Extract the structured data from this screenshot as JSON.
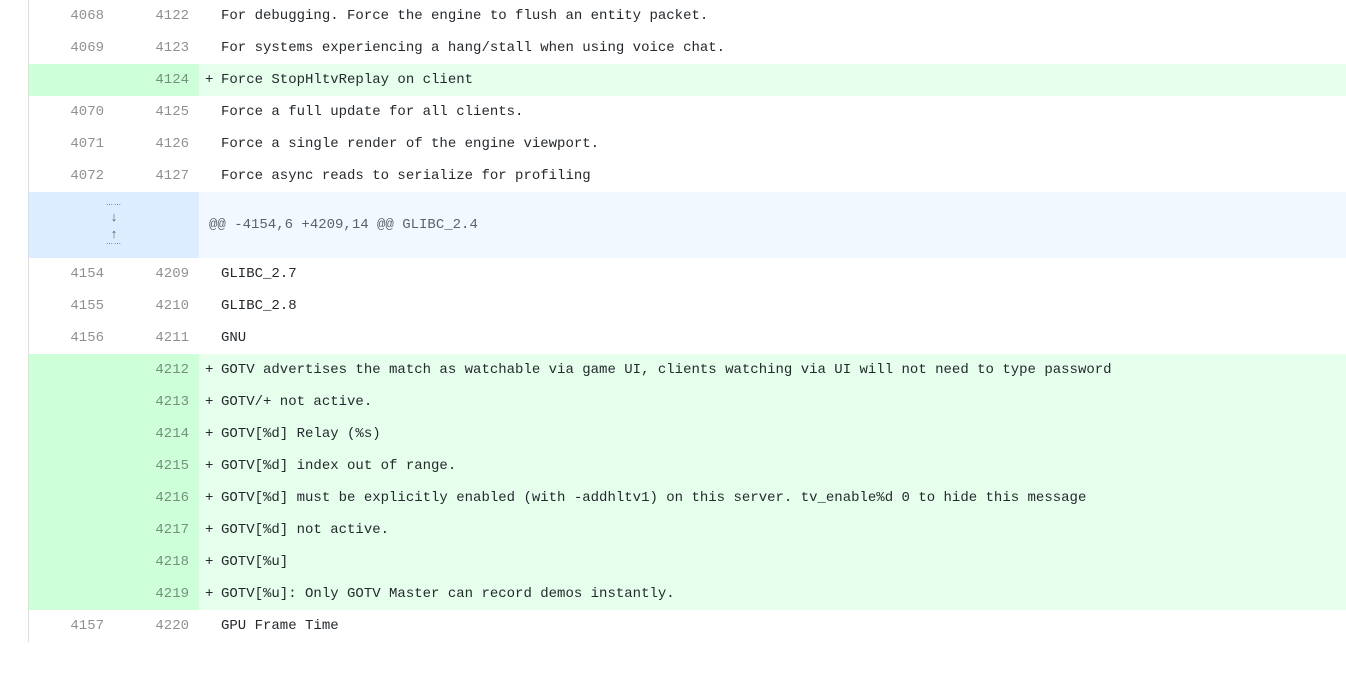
{
  "diff": {
    "rows": [
      {
        "type": "context",
        "old": "4068",
        "new": "4122",
        "marker": "",
        "text": "For debugging. Force the engine to flush an entity packet."
      },
      {
        "type": "context",
        "old": "4069",
        "new": "4123",
        "marker": "",
        "text": "For systems experiencing a hang/stall when using voice chat."
      },
      {
        "type": "addition",
        "old": "",
        "new": "4124",
        "marker": "+",
        "text": "Force StopHltvReplay on client"
      },
      {
        "type": "context",
        "old": "4070",
        "new": "4125",
        "marker": "",
        "text": "Force a full update for all clients."
      },
      {
        "type": "context",
        "old": "4071",
        "new": "4126",
        "marker": "",
        "text": "Force a single render of the engine viewport."
      },
      {
        "type": "context",
        "old": "4072",
        "new": "4127",
        "marker": "",
        "text": "Force async reads to serialize for profiling"
      },
      {
        "type": "hunk",
        "text": "@@ -4154,6 +4209,14 @@ GLIBC_2.4"
      },
      {
        "type": "context",
        "old": "4154",
        "new": "4209",
        "marker": "",
        "text": "GLIBC_2.7"
      },
      {
        "type": "context",
        "old": "4155",
        "new": "4210",
        "marker": "",
        "text": "GLIBC_2.8"
      },
      {
        "type": "context",
        "old": "4156",
        "new": "4211",
        "marker": "",
        "text": "GNU"
      },
      {
        "type": "addition",
        "old": "",
        "new": "4212",
        "marker": "+",
        "text": "GOTV advertises the match as watchable via game UI, clients watching via UI will not need to type password"
      },
      {
        "type": "addition",
        "old": "",
        "new": "4213",
        "marker": "+",
        "text": "GOTV/+ not active."
      },
      {
        "type": "addition",
        "old": "",
        "new": "4214",
        "marker": "+",
        "text": "GOTV[%d] Relay (%s)"
      },
      {
        "type": "addition",
        "old": "",
        "new": "4215",
        "marker": "+",
        "text": "GOTV[%d] index out of range."
      },
      {
        "type": "addition",
        "old": "",
        "new": "4216",
        "marker": "+",
        "text": "GOTV[%d] must be explicitly enabled (with -addhltv1) on this server. tv_enable%d 0 to hide this message"
      },
      {
        "type": "addition",
        "old": "",
        "new": "4217",
        "marker": "+",
        "text": "GOTV[%d] not active."
      },
      {
        "type": "addition",
        "old": "",
        "new": "4218",
        "marker": "+",
        "text": "GOTV[%u]"
      },
      {
        "type": "addition",
        "old": "",
        "new": "4219",
        "marker": "+",
        "text": "GOTV[%u]: Only GOTV Master can record demos instantly."
      },
      {
        "type": "context",
        "old": "4157",
        "new": "4220",
        "marker": "",
        "text": "GPU Frame Time"
      }
    ]
  }
}
